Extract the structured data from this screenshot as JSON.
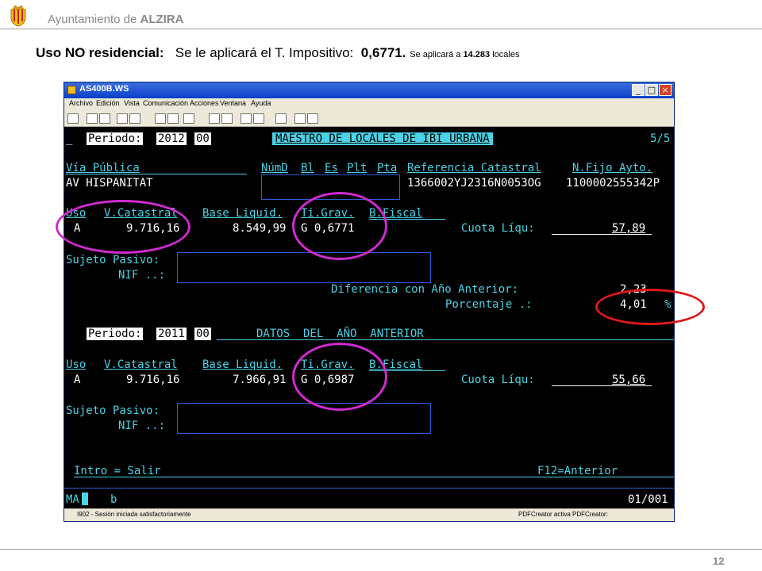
{
  "slide": {
    "org_prefix": "Ayuntamiento de ",
    "org_name": "ALZIRA",
    "heading_label": "Uso NO residencial:",
    "heading_text": "Se le aplicará el T. Impositivo:",
    "heading_rate": "0,6771.",
    "heading_small_prefix": "Se aplicará a ",
    "heading_small_count": "14.283",
    "heading_small_suffix": " locales",
    "page_number": "12"
  },
  "window": {
    "title": "AS400B.WS",
    "menu": [
      "Archivo",
      "Edición",
      "Vista",
      "Comunicación",
      "Acciones",
      "Ventana",
      "Ayuda"
    ],
    "buttons": {
      "minimize": "_",
      "maximize": "□",
      "close": "×"
    },
    "status_left": "I902 - Sesión iniciada satisfactoriamente",
    "status_right": "PDFCreator activa PDFCreator:"
  },
  "terminal": {
    "cursor": "_",
    "period_label": "Periodo:",
    "period_year": "2012",
    "period_code": "00",
    "screen_title": "MAESTRO DE LOCALES DE IBI URBANA",
    "page_indicator": "5/5",
    "col_via": "Vía Pública",
    "col_numd": "NúmD",
    "col_bl": "Bl",
    "col_es": "Es",
    "col_plt": "Plt",
    "col_pta": "Pta",
    "col_ref": "Referencia Catastral",
    "col_nfijo": "N.Fijo Ayto.",
    "via_value": "AV HISPANITAT",
    "ref_value": "1366002YJ2316N0053OG",
    "nfijo_value": "1100002555342P",
    "col_uso": "Uso",
    "col_vcat": "V.Catastral",
    "col_base": "Base Liquid.",
    "col_tigrav": "Ti.Grav.",
    "col_bfiscal": "B.Fiscal",
    "uso_value": "A",
    "vcat_value": "9.716,16",
    "base_value": "8.549,99",
    "tigrav_value": "G 0,6771",
    "cuota_label": "Cuota Líqu:",
    "cuota_value": "57,89",
    "sujeto_label": "Sujeto Pasivo:",
    "nif_label": "NIF ..:",
    "diferencia_label": "Diferencia con Año Anterior:",
    "diferencia_value": "2,23",
    "porcentaje_label": "Porcentaje .:",
    "porcentaje_value": "4,01",
    "porcentaje_unit": "%",
    "prev_period_label": "Periodo:",
    "prev_period_year": "2011",
    "prev_period_code": "00",
    "prev_title": "DATOS  DEL  AÑO  ANTERIOR",
    "prev_uso_value": "A",
    "prev_vcat_value": "9.716,16",
    "prev_base_value": "7.966,91",
    "prev_tigrav_value": "G 0,6987",
    "prev_cuota_value": "55,66",
    "intro_label": "Intro = Salir",
    "f12_label": "F12=Anterior",
    "oia_ma": "MA",
    "oia_b": "b",
    "oia_pos": "01/001"
  },
  "colors": {
    "terminal_cyan": "#4ad2e6",
    "terminal_green": "#6fe06f",
    "annotation_magenta": "#d02ad0",
    "annotation_red": "#e01818"
  }
}
